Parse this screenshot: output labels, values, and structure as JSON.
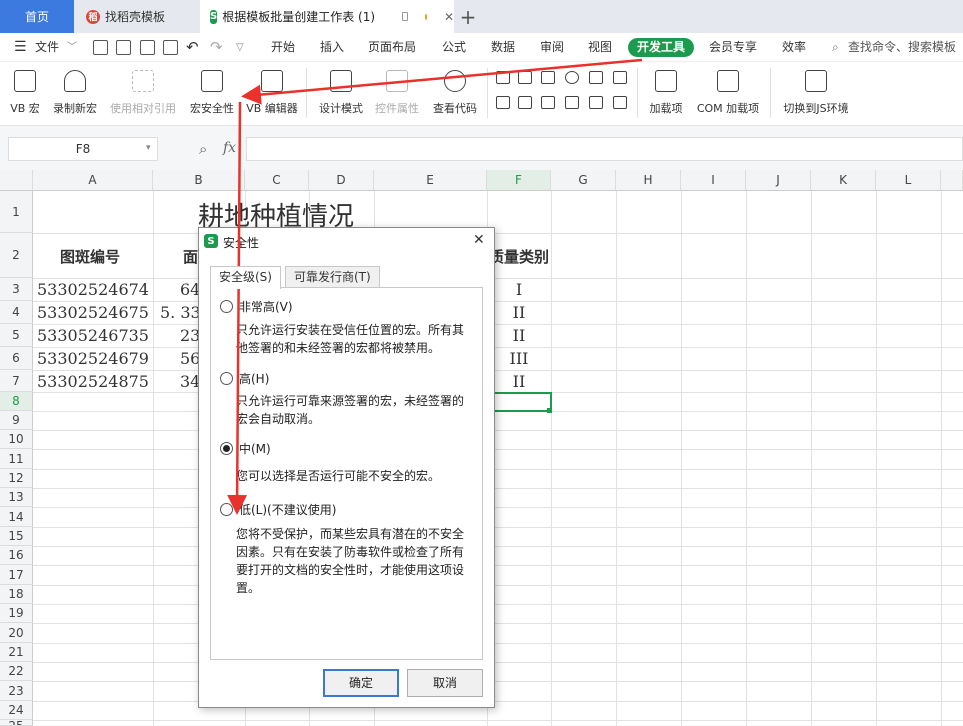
{
  "tabs": {
    "home": "首页",
    "template": "找稻壳模板",
    "document": "根据模板批量创建工作表 (1)",
    "close": "✕",
    "add": "+"
  },
  "menu": {
    "file": "文件",
    "items": [
      "开始",
      "插入",
      "页面布局",
      "公式",
      "数据",
      "审阅",
      "视图"
    ],
    "developer": "开发工具",
    "member": "会员专享",
    "efficiency": "效率",
    "search": "查找命令、搜索模板"
  },
  "ribbon": {
    "vb_macro": "VB 宏",
    "record_macro": "录制新宏",
    "relative_ref": "使用相对引用",
    "macro_security": "宏安全性",
    "vb_editor": "VB 编辑器",
    "design_mode": "设计模式",
    "control_props": "控件属性",
    "view_code": "查看代码",
    "addins": "加载项",
    "com_addins": "COM 加载项",
    "js_env": "切换到JS环境"
  },
  "formula_bar": {
    "name_box": "F8",
    "fx": "fx",
    "value": ""
  },
  "sheet": {
    "columns": [
      "A",
      "B",
      "C",
      "D",
      "E",
      "F",
      "G",
      "H",
      "I",
      "J",
      "K",
      "L"
    ],
    "rows": [
      "1",
      "2",
      "3",
      "4",
      "5",
      "6",
      "7",
      "8",
      "9",
      "10",
      "11",
      "12",
      "13",
      "14",
      "15",
      "16",
      "17",
      "18",
      "19",
      "20",
      "21",
      "22",
      "23",
      "24",
      "25"
    ],
    "title": "耕地种植情况",
    "header_a": "图斑编号",
    "header_b": "面",
    "header_f": "质量类别",
    "col_a": [
      "53302524674",
      "53302524675",
      "53305246735",
      "53302524679",
      "53302524875"
    ],
    "col_b": [
      "64",
      "5. 33",
      "23",
      "56",
      "34"
    ],
    "col_f": [
      "I",
      "II",
      "II",
      "III",
      "II"
    ]
  },
  "dialog": {
    "title": "安全性",
    "tab_level": "安全级(S)",
    "tab_publishers": "可靠发行商(T)",
    "options": [
      {
        "label": "非常高(V)",
        "desc": [
          "只允许运行安装在受信任位置的宏。所有其",
          "他签署的和未经签署的宏都将被禁用。"
        ]
      },
      {
        "label": "高(H)",
        "desc": [
          "只允许运行可靠来源签署的宏，未经签署的",
          "宏会自动取消。"
        ]
      },
      {
        "label": "中(M)",
        "desc": [
          "您可以选择是否运行可能不安全的宏。"
        ]
      },
      {
        "label": "低(L)(不建议使用)",
        "desc": [
          "您将不受保护，而某些宏具有潜在的不安全",
          "因素。只有在安装了防毒软件或检查了所有",
          "要打开的文档的安全性时，才能使用这项设",
          "置。"
        ]
      }
    ],
    "selected": "中(M)",
    "ok": "确定",
    "cancel": "取消"
  },
  "colors": {
    "accent": "#1c9b4e",
    "home_tab": "#3d7ae0",
    "annotation_arrow": "#e8322b",
    "selection": "#1c9b4e"
  }
}
